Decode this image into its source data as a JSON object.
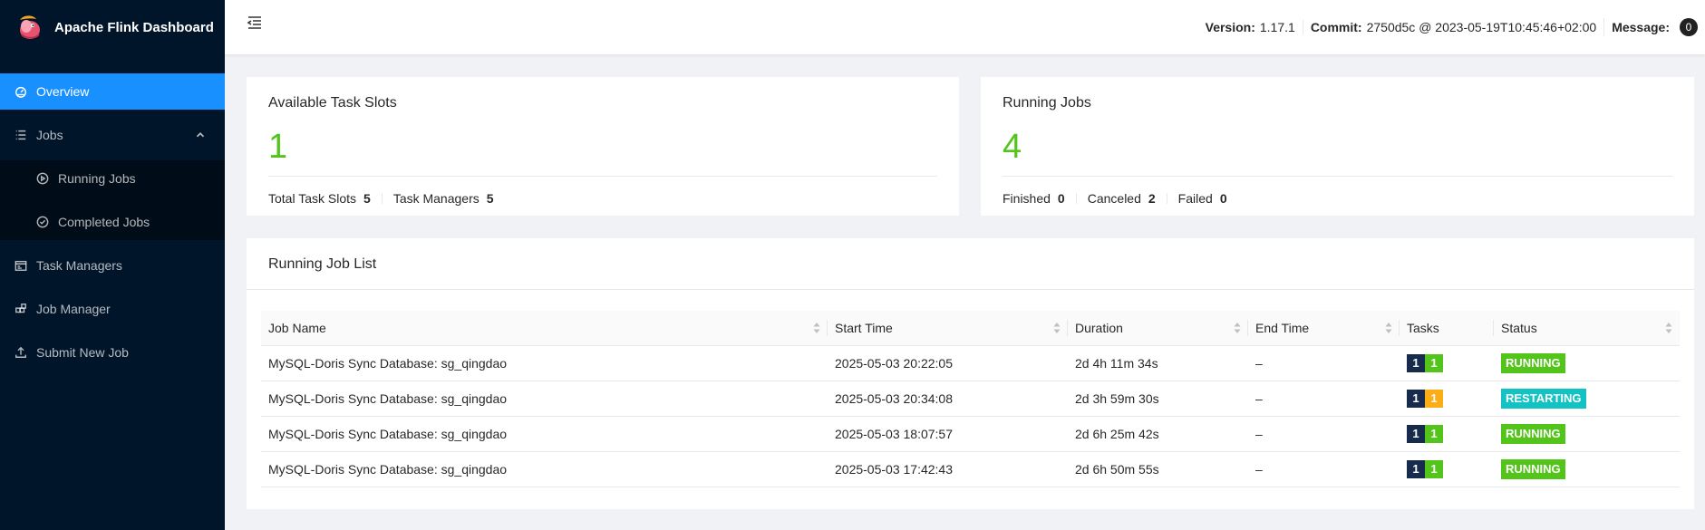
{
  "app": {
    "title": "Apache Flink Dashboard"
  },
  "sidebar": {
    "items": [
      {
        "label": "Overview",
        "icon": "dashboard-icon",
        "active": true
      },
      {
        "label": "Jobs",
        "icon": "list-icon",
        "expanded": true,
        "children": [
          {
            "label": "Running Jobs",
            "icon": "play-circle-icon"
          },
          {
            "label": "Completed Jobs",
            "icon": "check-circle-icon"
          }
        ]
      },
      {
        "label": "Task Managers",
        "icon": "schedule-icon"
      },
      {
        "label": "Job Manager",
        "icon": "build-icon"
      },
      {
        "label": "Submit New Job",
        "icon": "upload-icon"
      }
    ]
  },
  "header": {
    "version_label": "Version:",
    "version": "1.17.1",
    "commit_label": "Commit:",
    "commit": "2750d5c @ 2023-05-19T10:45:46+02:00",
    "message_label": "Message:",
    "message_count": "0"
  },
  "slots_card": {
    "title": "Available Task Slots",
    "value": "1",
    "total_label": "Total Task Slots",
    "total": "5",
    "tm_label": "Task Managers",
    "tm": "5"
  },
  "jobs_card": {
    "title": "Running Jobs",
    "value": "4",
    "finished_label": "Finished",
    "finished": "0",
    "canceled_label": "Canceled",
    "canceled": "2",
    "failed_label": "Failed",
    "failed": "0"
  },
  "job_list": {
    "title": "Running Job List",
    "columns": [
      "Job Name",
      "Start Time",
      "Duration",
      "End Time",
      "Tasks",
      "Status"
    ],
    "rows": [
      {
        "name": "MySQL-Doris Sync Database: sg_qingdao",
        "start": "2025-05-03 20:22:05",
        "duration": "2d 4h 11m 34s",
        "end": "–",
        "tasks": [
          "1",
          "1"
        ],
        "task_colors": [
          "#172b4d",
          "#52c41a"
        ],
        "status": "RUNNING",
        "status_color": "#52c41a"
      },
      {
        "name": "MySQL-Doris Sync Database: sg_qingdao",
        "start": "2025-05-03 20:34:08",
        "duration": "2d 3h 59m 30s",
        "end": "–",
        "tasks": [
          "1",
          "1"
        ],
        "task_colors": [
          "#172b4d",
          "#faad14"
        ],
        "status": "RESTARTING",
        "status_color": "#13c2c2"
      },
      {
        "name": "MySQL-Doris Sync Database: sg_qingdao",
        "start": "2025-05-03 18:07:57",
        "duration": "2d 6h 25m 42s",
        "end": "–",
        "tasks": [
          "1",
          "1"
        ],
        "task_colors": [
          "#172b4d",
          "#52c41a"
        ],
        "status": "RUNNING",
        "status_color": "#52c41a"
      },
      {
        "name": "MySQL-Doris Sync Database: sg_qingdao",
        "start": "2025-05-03 17:42:43",
        "duration": "2d 6h 50m 55s",
        "end": "–",
        "tasks": [
          "1",
          "1"
        ],
        "task_colors": [
          "#172b4d",
          "#52c41a"
        ],
        "status": "RUNNING",
        "status_color": "#52c41a"
      }
    ]
  }
}
